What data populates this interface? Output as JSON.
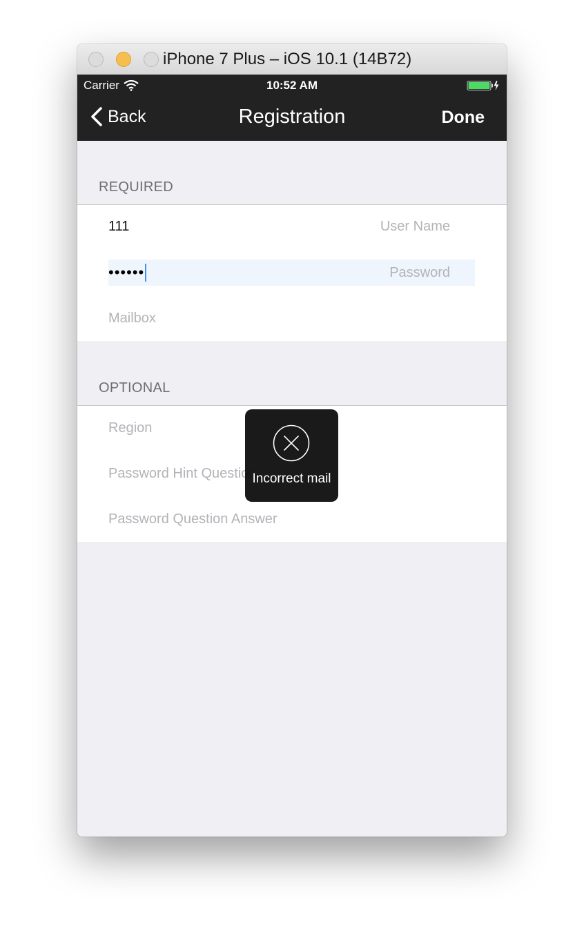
{
  "window": {
    "title": "iPhone 7 Plus – iOS 10.1 (14B72)"
  },
  "status_bar": {
    "carrier": "Carrier",
    "time": "10:52 AM",
    "icons": [
      "wifi-icon",
      "battery-icon"
    ]
  },
  "nav": {
    "back_label": "Back",
    "title": "Registration",
    "done_label": "Done",
    "background": "#222222"
  },
  "required": {
    "header": "REQUIRED",
    "user_name": {
      "value": "111",
      "placeholder": "User Name"
    },
    "password": {
      "value": "••••••",
      "placeholder": "Password"
    },
    "mailbox": {
      "placeholder": "Mailbox"
    }
  },
  "optional": {
    "header": "OPTIONAL",
    "region": {
      "placeholder": "Region"
    },
    "hint_question": {
      "placeholder": "Password Hint Question"
    },
    "question_answer": {
      "placeholder": "Password Question Answer"
    }
  },
  "toast": {
    "message": "Incorrect mail",
    "icon": "close-circle-icon"
  },
  "colors": {
    "background": "#efeff4",
    "section_header": "#6d6d72",
    "placeholder": "#b3b3b8",
    "focus_highlight": "#eef5fd",
    "battery": "#4cd964"
  }
}
